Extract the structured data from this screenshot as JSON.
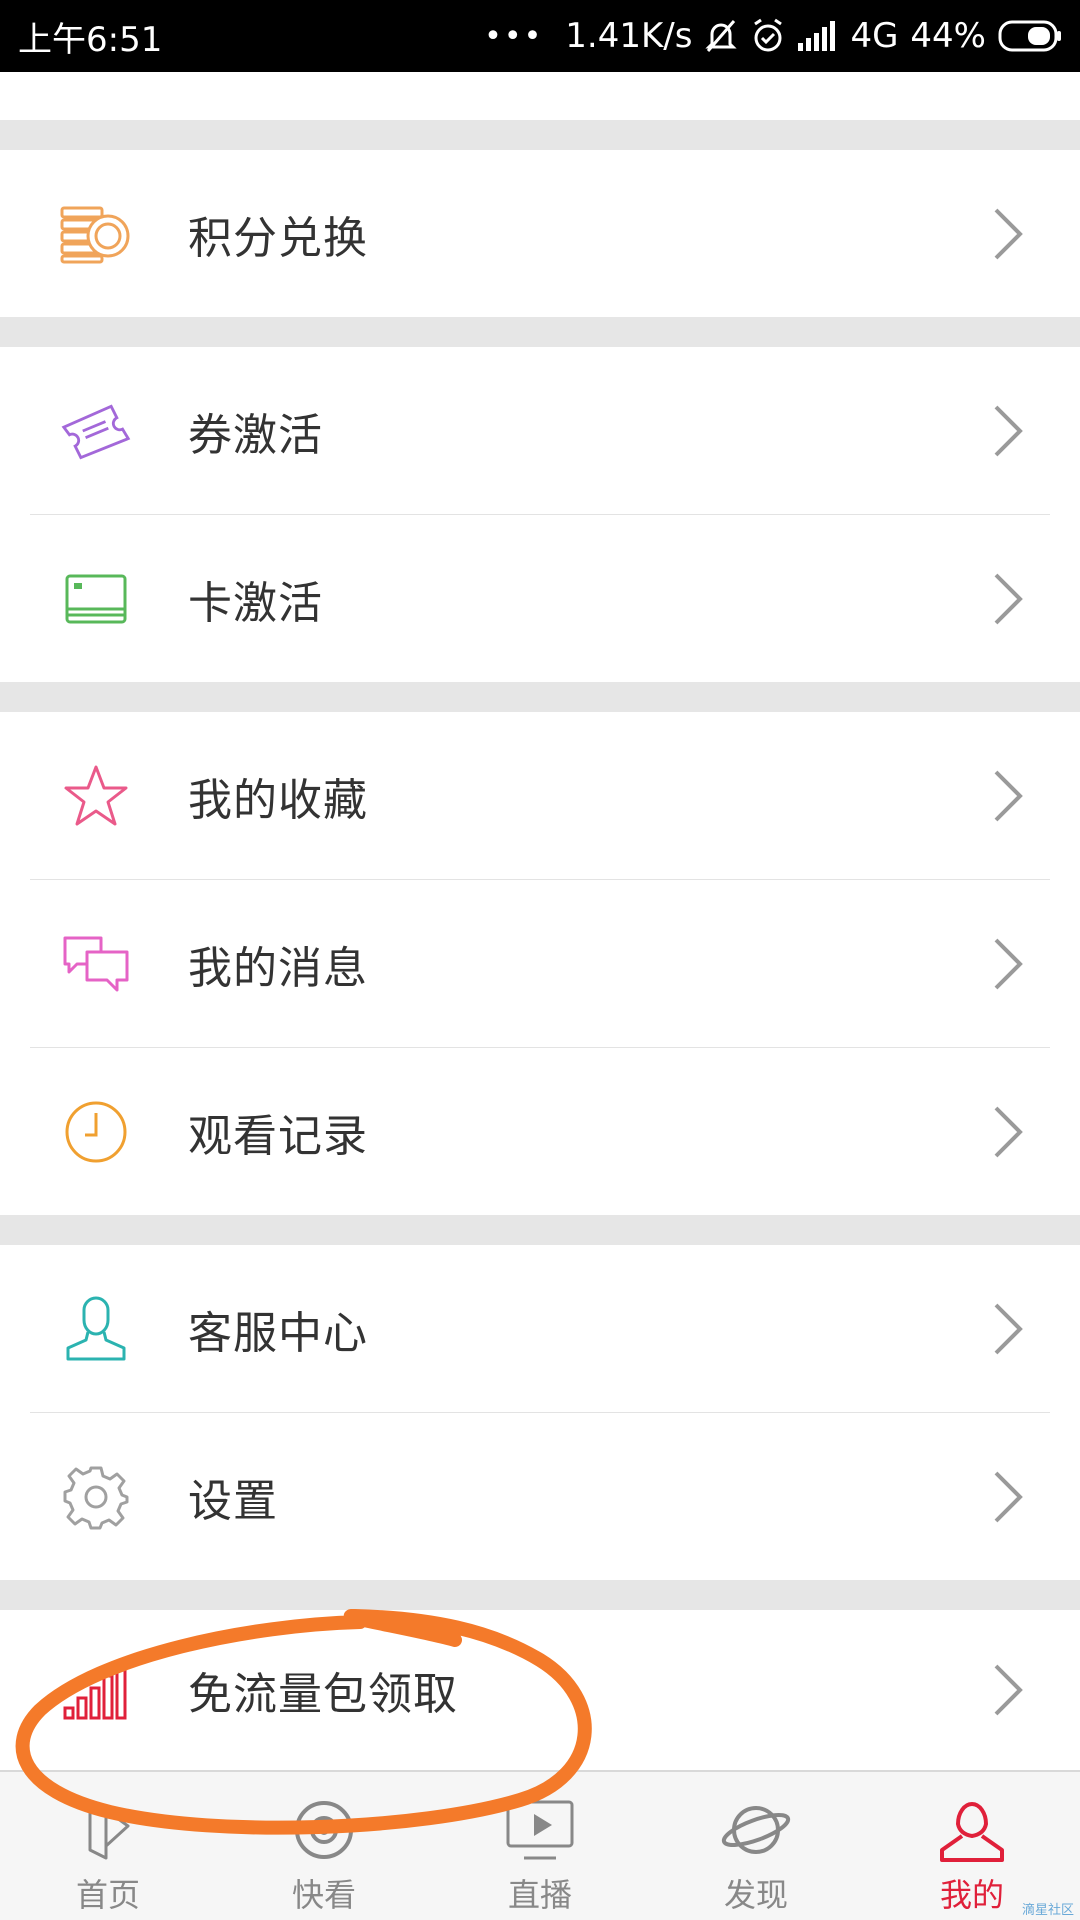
{
  "status_bar": {
    "time": "上午6:51",
    "dots": "•••",
    "speed": "1.41K/s",
    "network": "4G",
    "battery": "44%"
  },
  "menu": {
    "points_exchange": "积分兑换",
    "coupon_activate": "券激活",
    "card_activate": "卡激活",
    "favorites": "我的收藏",
    "messages": "我的消息",
    "history": "观看记录",
    "service": "客服中心",
    "settings": "设置",
    "free_data": "免流量包领取"
  },
  "nav": {
    "home": "首页",
    "quick": "快看",
    "live": "直播",
    "discover": "发现",
    "mine": "我的"
  },
  "colors": {
    "active_tab": "#e0203a",
    "annotation": "#f47a2a"
  },
  "watermark": "滴星社区"
}
